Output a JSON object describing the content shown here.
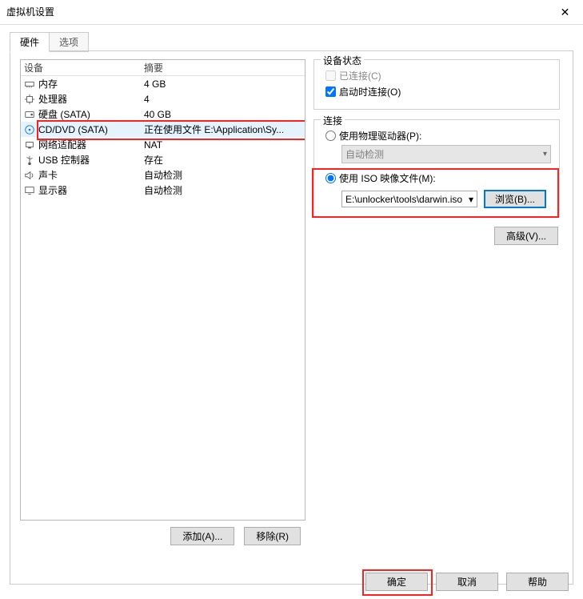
{
  "window": {
    "title": "虚拟机设置"
  },
  "tabs": [
    {
      "label": "硬件",
      "active": true
    },
    {
      "label": "选项",
      "active": false
    }
  ],
  "hw": {
    "headers": {
      "device": "设备",
      "summary": "摘要"
    },
    "rows": [
      {
        "device": "内存",
        "summary": "4 GB",
        "icon": "memory-icon",
        "sel": false
      },
      {
        "device": "处理器",
        "summary": "4",
        "icon": "cpu-icon",
        "sel": false
      },
      {
        "device": "硬盘 (SATA)",
        "summary": "40 GB",
        "icon": "hdd-icon",
        "sel": false
      },
      {
        "device": "CD/DVD (SATA)",
        "summary": "正在使用文件 E:\\Application\\Sy...",
        "icon": "disc-icon",
        "sel": true
      },
      {
        "device": "网络适配器",
        "summary": "NAT",
        "icon": "nic-icon",
        "sel": false
      },
      {
        "device": "USB 控制器",
        "summary": "存在",
        "icon": "usb-icon",
        "sel": false
      },
      {
        "device": "声卡",
        "summary": "自动检测",
        "icon": "sound-icon",
        "sel": false
      },
      {
        "device": "显示器",
        "summary": "自动检测",
        "icon": "display-icon",
        "sel": false
      }
    ],
    "add_btn": "添加(A)...",
    "remove_btn": "移除(R)"
  },
  "right": {
    "status_legend": "设备状态",
    "connected_label": "已连接(C)",
    "connected_checked": false,
    "connect_startup_label": "启动时连接(O)",
    "connect_startup_checked": true,
    "conn_legend": "连接",
    "use_physical_label": "使用物理驱动器(P):",
    "physical_value": "自动检测",
    "use_iso_label": "使用 ISO 映像文件(M):",
    "iso_value": "E:\\unlocker\\tools\\darwin.iso",
    "browse_btn": "浏览(B)...",
    "advanced_btn": "高级(V)..."
  },
  "footer": {
    "ok": "确定",
    "cancel": "取消",
    "help": "帮助"
  }
}
